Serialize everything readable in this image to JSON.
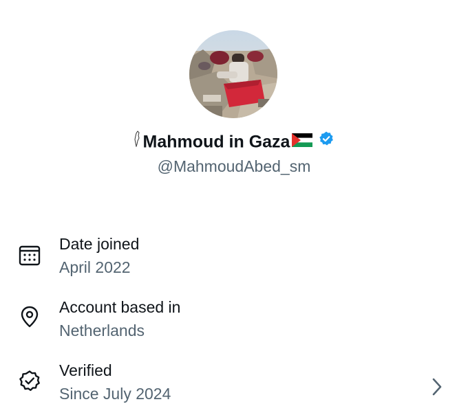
{
  "profile": {
    "display_name": "Mahmoud in Gaza",
    "handle": "@MahmoudAbed_sm",
    "avatar_icon": "profile-photo",
    "flag_icon": "palestine-flag",
    "map_icon": "palestine-map-silhouette",
    "verified_icon": "verified-badge",
    "verified_color": "#1d9bf0"
  },
  "about": {
    "date_joined": {
      "label": "Date joined",
      "value": "April 2022",
      "icon": "calendar-icon"
    },
    "location": {
      "label": "Account based in",
      "value": "Netherlands",
      "icon": "location-pin-icon"
    },
    "verified": {
      "label": "Verified",
      "value": "Since July 2024",
      "icon": "verified-check-icon",
      "chevron_icon": "chevron-right-icon"
    }
  },
  "colors": {
    "text_primary": "#0f1419",
    "text_secondary": "#536471",
    "background": "#ffffff"
  }
}
